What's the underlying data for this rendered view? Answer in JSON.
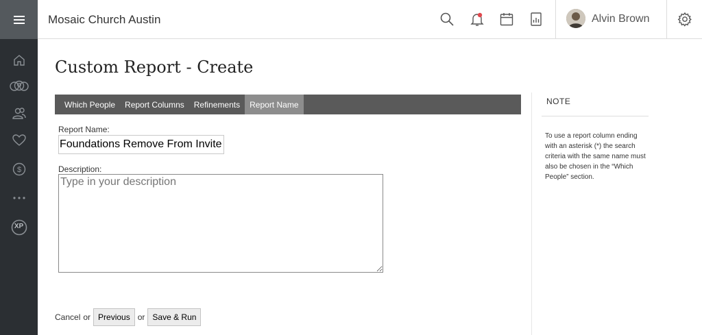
{
  "header": {
    "org_name": "Mosaic Church Austin",
    "user_name": "Alvin Brown",
    "notification_dot_color": "#e0484d"
  },
  "sidebar": {
    "items": [
      {
        "icon": "home-icon"
      },
      {
        "icon": "groups-icon"
      },
      {
        "icon": "people-icon"
      },
      {
        "icon": "heart-icon"
      },
      {
        "icon": "dollar-icon"
      },
      {
        "icon": "more-icon"
      },
      {
        "icon": "xp-icon",
        "label": "XP"
      }
    ]
  },
  "page": {
    "title": "Custom Report - Create"
  },
  "tabs": [
    {
      "label": "Which People",
      "active": false
    },
    {
      "label": "Report Columns",
      "active": false
    },
    {
      "label": "Refinements",
      "active": false
    },
    {
      "label": "Report Name",
      "active": true
    }
  ],
  "form": {
    "report_name_label": "Report Name:",
    "report_name_value": "Foundations Remove From Invite",
    "description_label": "Description:",
    "description_placeholder": "Type in your description"
  },
  "actions": {
    "cancel_label": "Cancel",
    "or_1": "or",
    "previous_label": "Previous",
    "or_2": "or",
    "save_run_label": "Save & Run"
  },
  "note": {
    "title": "NOTE",
    "text": "To use a report column ending with an asterisk (*) the search criteria with the same name must also be chosen in the “Which People” section."
  }
}
